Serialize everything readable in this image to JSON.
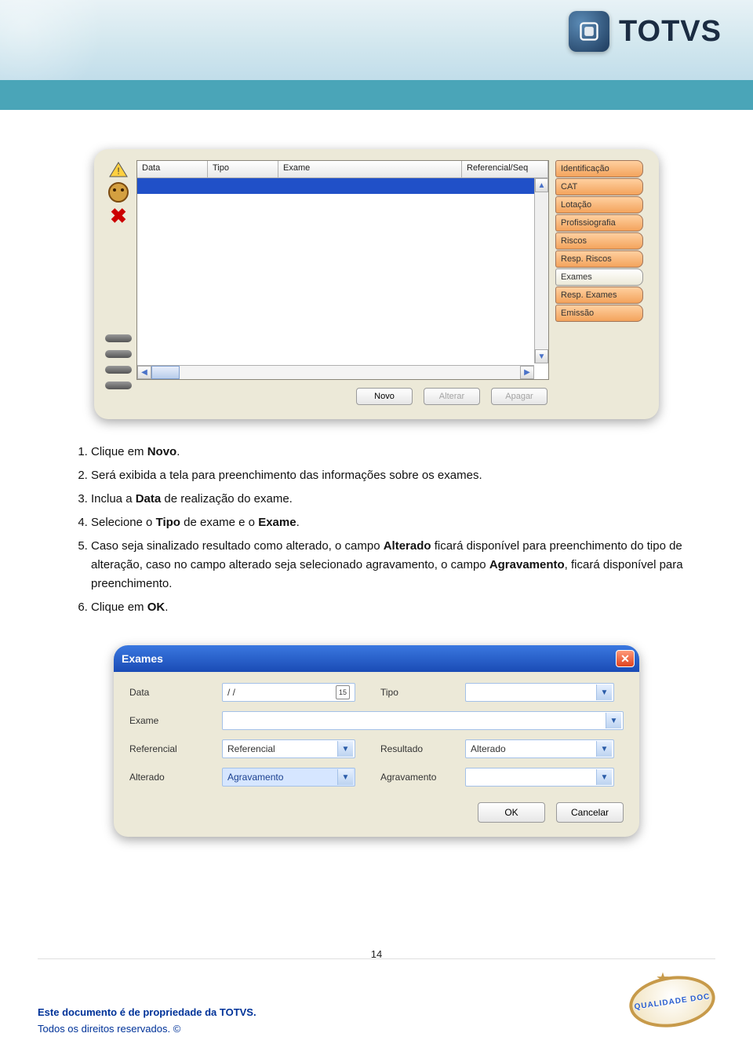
{
  "header": {
    "brand": "TOTVS"
  },
  "screenshot1": {
    "columns": [
      "Data",
      "Tipo",
      "Exame",
      "Referencial/Seq"
    ],
    "buttons": {
      "novo": "Novo",
      "alterar": "Alterar",
      "apagar": "Apagar"
    },
    "tabs": [
      "Identificação",
      "CAT",
      "Lotação",
      "Profissiografia",
      "Riscos",
      "Resp. Riscos",
      "Exames",
      "Resp. Exames",
      "Emissão"
    ],
    "active_tab_index": 6
  },
  "instructions": {
    "i1a": "Clique em ",
    "i1b": "Novo",
    "i1c": ".",
    "i2": "Será exibida a tela para preenchimento das informações sobre os exames.",
    "i3a": "Inclua a ",
    "i3b": "Data",
    "i3c": " de realização do exame.",
    "i4a": "Selecione o ",
    "i4b": "Tipo",
    "i4c": " de exame e o ",
    "i4d": "Exame",
    "i4e": ".",
    "i5a": "Caso seja sinalizado resultado como alterado, o campo ",
    "i5b": "Alterado",
    "i5c": " ficará disponível para preenchimento do tipo de alteração, caso no campo alterado seja selecionado agravamento, o campo ",
    "i5d": "Agravamento",
    "i5e": ", ficará disponível para preenchimento.",
    "i6a": "Clique em ",
    "i6b": "OK",
    "i6c": "."
  },
  "dialog": {
    "title": "Exames",
    "labels": {
      "data": "Data",
      "tipo": "Tipo",
      "exame": "Exame",
      "referencial": "Referencial",
      "resultado": "Resultado",
      "alterado": "Alterado",
      "agravamento": "Agravamento"
    },
    "values": {
      "data": "/  /",
      "tipo": "",
      "exame": "",
      "referencial": "Referencial",
      "resultado": "Alterado",
      "alterado": "Agravamento",
      "agravamento": ""
    },
    "buttons": {
      "ok": "OK",
      "cancel": "Cancelar"
    },
    "cal_icon": "15"
  },
  "footer": {
    "line1": "Este documento é de propriedade da TOTVS.",
    "line2": "Todos os direitos reservados. ©",
    "page": "14",
    "stamp": "QUALIDADE DOC"
  }
}
